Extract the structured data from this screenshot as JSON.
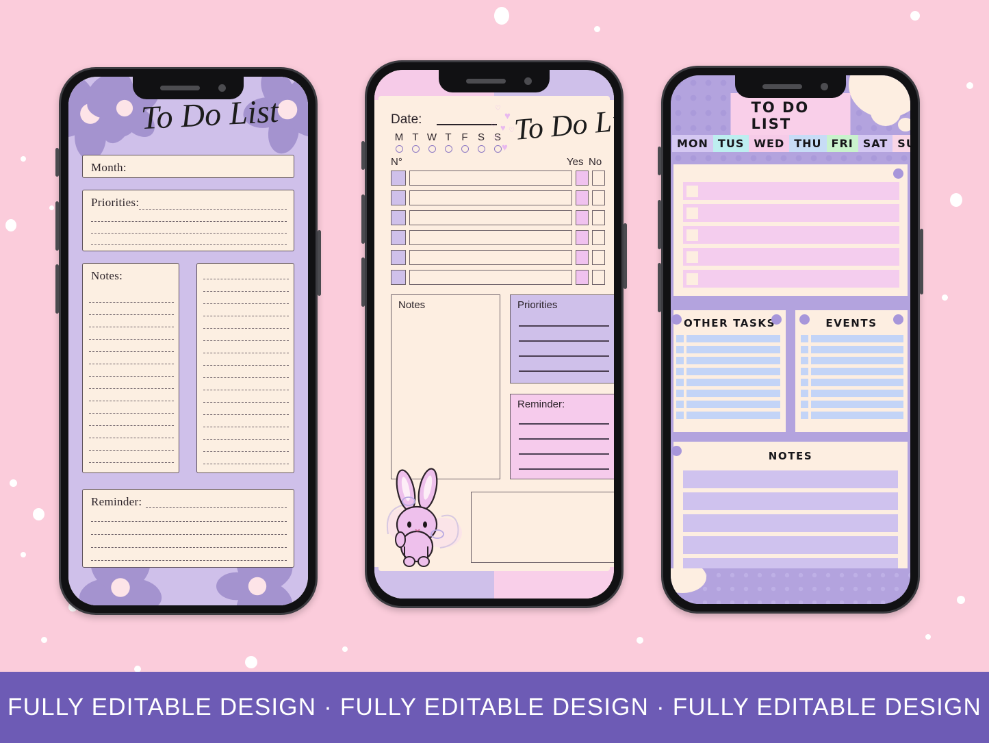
{
  "background": {
    "color": "#fbccdb",
    "dot_color": "#ffffff"
  },
  "footer": {
    "text": "· FULLY EDITABLE DESIGN · FULLY EDITABLE DESIGN · FULLY EDITABLE DESIGN ·"
  },
  "phone1": {
    "title": "To Do List",
    "theme": {
      "page": "#cfc0ea",
      "card": "#fcefe2",
      "flower": "#a493cf",
      "flower_center": "#fde4e8"
    },
    "month_label": "Month:",
    "priorities_label": "Priorities:",
    "priorities_lines": 4,
    "notes_label": "Notes:",
    "notes_left_lines": 14,
    "notes_right_lines": 16,
    "reminder_label": "Reminder:",
    "reminder_lines": 5
  },
  "phone2": {
    "title": "To Do List",
    "theme": {
      "page": "#fdeee1",
      "frame_pink": "#f6cbe8",
      "frame_purple": "#cfc0ea",
      "num_box": "#cfc0ea",
      "yes_box": "#f0c2ef",
      "priorities_box": "#cfc0ea",
      "reminder_box": "#f6cbec"
    },
    "date_label": "Date:",
    "days": [
      "M",
      "T",
      "W",
      "T",
      "F",
      "S",
      "S"
    ],
    "table_headers": {
      "num": "N°",
      "yes": "Yes",
      "no": "No"
    },
    "task_rows": 6,
    "notes_label": "Notes",
    "priorities_label": "Priorities",
    "priorities_lines": 4,
    "reminder_label": "Reminder:",
    "reminder_lines": 4,
    "mascot": "bunny-icon"
  },
  "phone3": {
    "banner_title": "TO DO LIST",
    "theme": {
      "frame": "#b3a3de",
      "panel": "#fdeee1",
      "banner": "#f9cfe9",
      "task_row": "#f4cdee",
      "blue_row": "#c3d4f7",
      "note_row": "#cfc2ee",
      "dot": "#a796da"
    },
    "days": [
      {
        "label": "MON",
        "color": "#d5c8f2"
      },
      {
        "label": "TUS",
        "color": "#bdeef0"
      },
      {
        "label": "WED",
        "color": "#f6cbe8"
      },
      {
        "label": "THU",
        "color": "#c7dcf6"
      },
      {
        "label": "FRI",
        "color": "#c9f2cd"
      },
      {
        "label": "SAT",
        "color": "#d5c8f2"
      },
      {
        "label": "SUN",
        "color": "#f9d6e6"
      }
    ],
    "task_rows": 5,
    "other_tasks_label": "OTHER TASKS",
    "other_tasks_rows": 8,
    "events_label": "EVENTS",
    "events_rows": 8,
    "notes_label": "NOTES",
    "notes_rows": 5
  }
}
